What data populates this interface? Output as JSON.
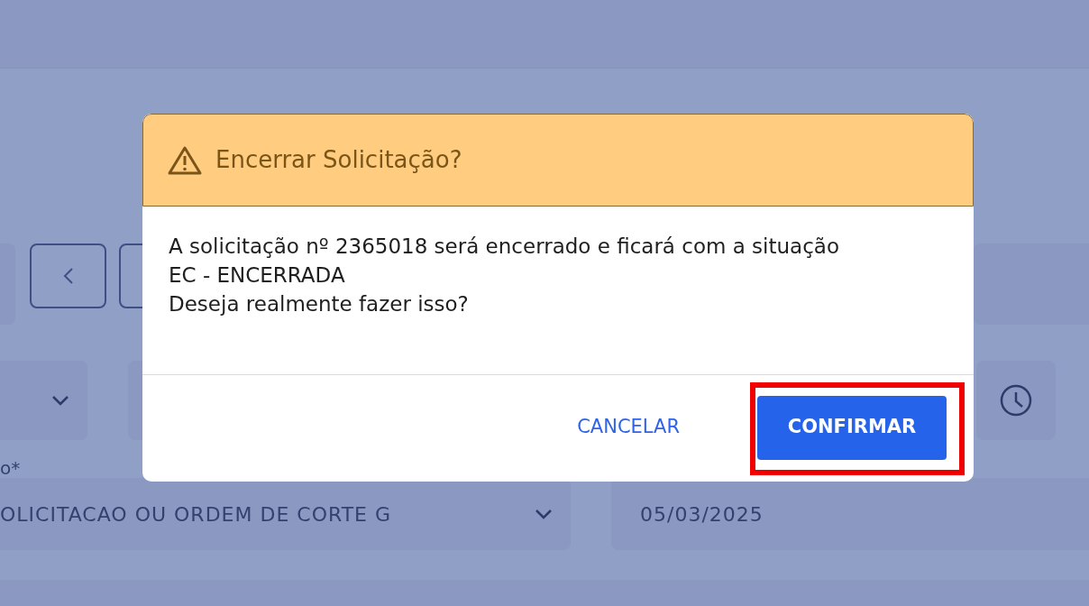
{
  "background": {
    "required_label": "o*",
    "order_type_select": {
      "value": "OLICITACAO OU ORDEM DE CORTE G"
    },
    "date_field": {
      "value": "05/03/2025"
    }
  },
  "dialog": {
    "kind": "warning",
    "title": "Encerrar Solicitação?",
    "message_lines": [
      "A solicitação nº 2365018 será encerrado e ficará com a situação",
      "EC - ENCERRADA",
      "Deseja realmente fazer isso?"
    ],
    "buttons": [
      {
        "label": "CANCELAR",
        "kind": "text",
        "highlighted": false
      },
      {
        "label": "CONFIRMAR",
        "kind": "primary",
        "highlighted": true
      }
    ]
  }
}
